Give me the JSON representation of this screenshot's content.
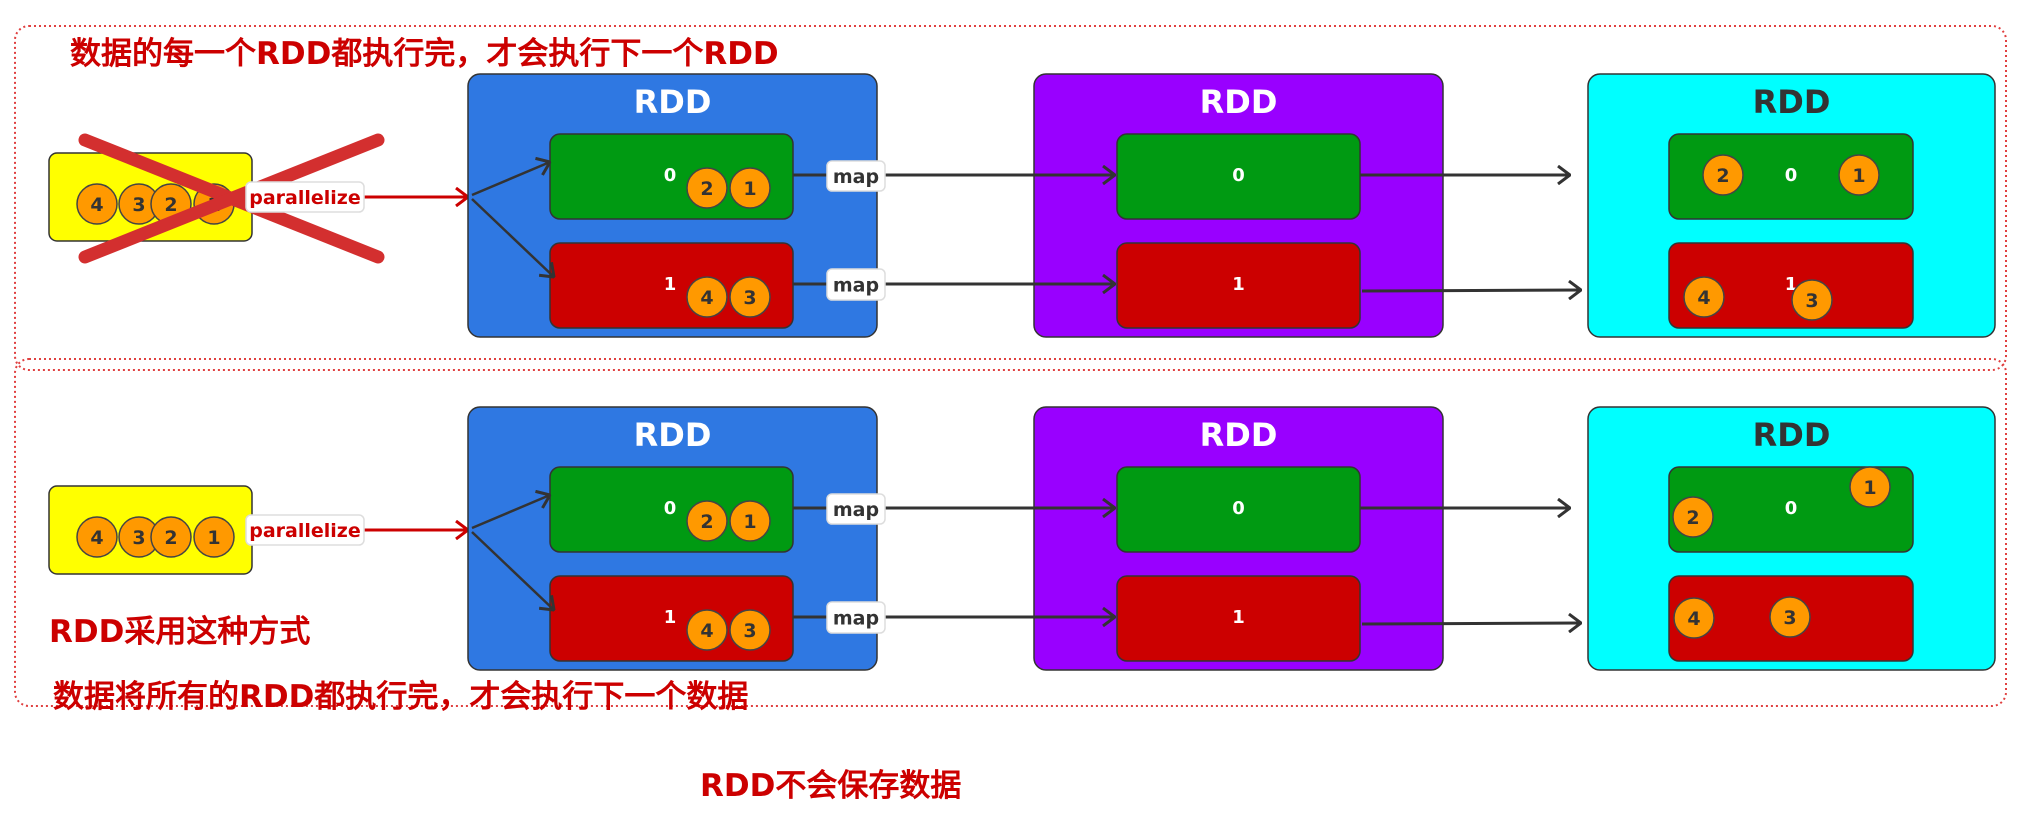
{
  "colors": {
    "note_red": "#cc0000",
    "frame_dotted": "#e04040",
    "source_yellow": "#ffff00",
    "rdd1_blue": "#2f78e2",
    "rdd2_purple": "#9900ff",
    "rdd3_cyan": "#00ffff",
    "partition_green": "#009a12",
    "partition_red": "#cc0000",
    "element_orange": "#ff9900",
    "cross_red": "#d32f2f"
  },
  "notes": {
    "top_heading": "数据的每一个RDD都执行完，才会执行下一个RDD",
    "rdd_way": "RDD采用这种方式",
    "bottom_heading": "数据将所有的RDD都执行完，才会执行下一个数据",
    "footer": "RDD不会保存数据"
  },
  "sections": [
    {
      "crossed_out": true,
      "source_elements": [
        "4",
        "3",
        "2",
        "1"
      ],
      "parallelize_label": "parallelize",
      "rdds": [
        {
          "title": "RDD",
          "partitions": [
            {
              "label": "0",
              "elements": [
                "2",
                "1"
              ]
            },
            {
              "label": "1",
              "elements": [
                "4",
                "3"
              ]
            }
          ]
        },
        {
          "title": "RDD",
          "partitions": [
            {
              "label": "0",
              "elements": []
            },
            {
              "label": "1",
              "elements": []
            }
          ]
        },
        {
          "title": "RDD",
          "partitions": [
            {
              "label": "0",
              "elements": [
                "2",
                "1"
              ]
            },
            {
              "label": "1",
              "elements": [
                "4",
                "3"
              ]
            }
          ]
        }
      ],
      "map_labels": [
        "map",
        "map"
      ]
    },
    {
      "crossed_out": false,
      "source_elements": [
        "4",
        "3",
        "2",
        "1"
      ],
      "parallelize_label": "parallelize",
      "rdds": [
        {
          "title": "RDD",
          "partitions": [
            {
              "label": "0",
              "elements": [
                "2",
                "1"
              ]
            },
            {
              "label": "1",
              "elements": [
                "4",
                "3"
              ]
            }
          ]
        },
        {
          "title": "RDD",
          "partitions": [
            {
              "label": "0",
              "elements": []
            },
            {
              "label": "1",
              "elements": []
            }
          ]
        },
        {
          "title": "RDD",
          "partitions": [
            {
              "label": "0",
              "elements": [
                "2",
                "1"
              ]
            },
            {
              "label": "1",
              "elements": [
                "4",
                "3"
              ]
            }
          ]
        }
      ],
      "map_labels": [
        "map",
        "map"
      ]
    }
  ]
}
